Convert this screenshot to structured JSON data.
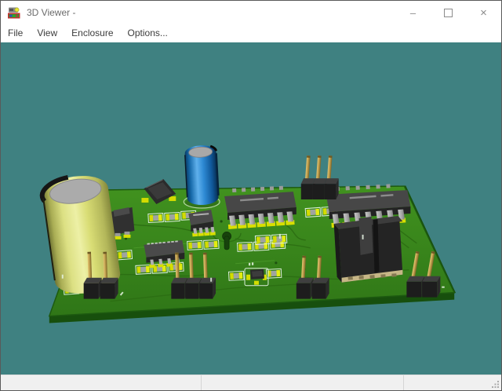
{
  "window": {
    "title": "3D Viewer -",
    "icon": "pcb-3d-viewer-icon",
    "controls": {
      "minimize_glyph": "–",
      "close_glyph": "×"
    }
  },
  "menu": {
    "items": [
      {
        "label": "File"
      },
      {
        "label": "View"
      },
      {
        "label": "Enclosure"
      },
      {
        "label": "Options..."
      }
    ]
  },
  "viewport": {
    "background_color": "#3F8181",
    "scene": "3D render of a green PCB viewed in perspective",
    "components": [
      "large-electrolytic-capacitor-yellow",
      "small-electrolytic-capacitor-blue",
      "power-inductor-black",
      "dpak-regulator",
      "soic8-ic-upper",
      "soic8-ic-lower",
      "soic14-ic-left",
      "soic14-ic-right",
      "relay-black",
      "pin-header-3pin-rear",
      "pin-header-3pin-front",
      "pin-header-2pin-left",
      "pin-header-2pin-center",
      "pin-header-2pin-right",
      "sot23-transistor",
      "smd-passive-clusters",
      "keyhole-slot"
    ]
  },
  "statusbar": {
    "sections": [
      "",
      "",
      ""
    ]
  },
  "colors": {
    "viewport_teal": "#3F8181",
    "board_green": "#3A8A1D",
    "board_edge_green": "#1A5410",
    "trace_green": "#2C6E13",
    "pad_yellow": "#D6DE00",
    "capacitor_yellow": "#D9DD75",
    "capacitor_blue": "#2E8AD4",
    "component_black": "#2B2B2B",
    "pin_gray": "#ACACAC",
    "header_gold": "#C4A350",
    "titlebar_bg": "#FFFFFF",
    "statusbar_bg": "#F0F0F0",
    "title_text": "#6B6B6B",
    "menu_text": "#3C3C3C"
  }
}
